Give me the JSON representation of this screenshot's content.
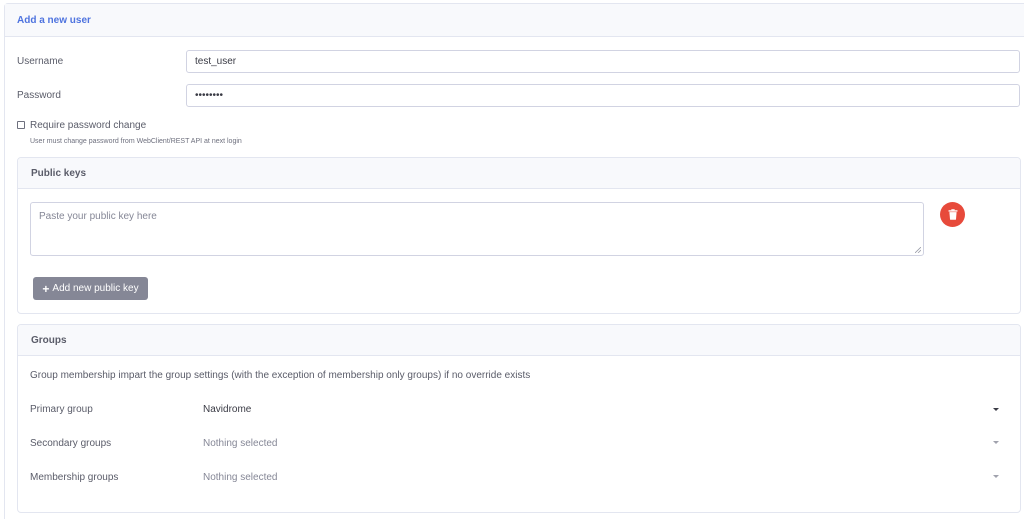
{
  "form": {
    "title": "Add a new user",
    "username": {
      "label": "Username",
      "value": "test_user"
    },
    "password": {
      "label": "Password",
      "value": "••••••••"
    },
    "require_password_change": {
      "label": "Require password change",
      "checked": false,
      "hint": "User must change password from WebClient/REST API at next login"
    }
  },
  "public_keys": {
    "title": "Public keys",
    "textarea_placeholder": "Paste your public key here",
    "delete_icon": "trash-icon",
    "add_button_label": "Add new public key",
    "add_icon": "plus-icon"
  },
  "groups": {
    "title": "Groups",
    "description": "Group membership impart the group settings (with the exception of membership only groups) if no override exists",
    "primary": {
      "label": "Primary group",
      "value": "Navidrome"
    },
    "secondary": {
      "label": "Secondary groups",
      "value": "Nothing selected"
    },
    "membership": {
      "label": "Membership groups",
      "value": "Nothing selected"
    }
  },
  "colors": {
    "accent": "#4e73df",
    "danger": "#e74a3b",
    "secondary_button": "#858796"
  }
}
